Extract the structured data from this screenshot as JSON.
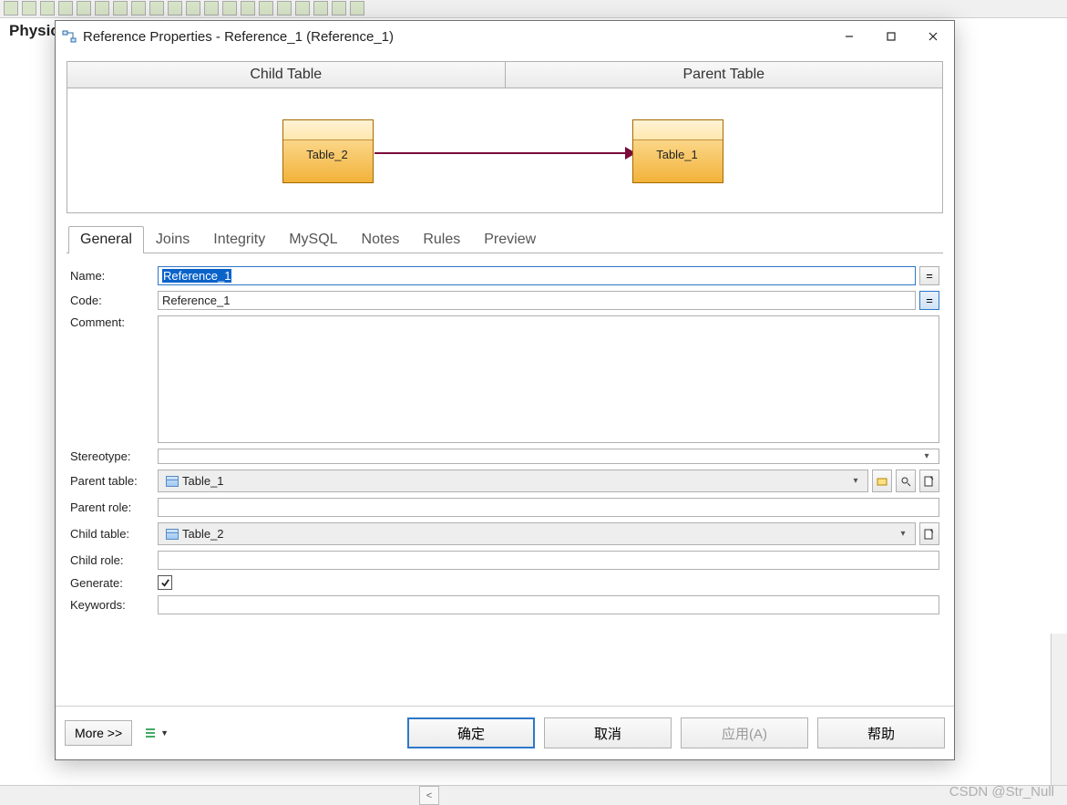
{
  "background": {
    "tab_label": "Physic"
  },
  "dialog": {
    "title": "Reference Properties - Reference_1 (Reference_1)",
    "rel": {
      "child_header": "Child Table",
      "parent_header": "Parent Table",
      "child_name": "Table_2",
      "parent_name": "Table_1"
    },
    "tabs": [
      "General",
      "Joins",
      "Integrity",
      "MySQL",
      "Notes",
      "Rules",
      "Preview"
    ],
    "active_tab": "General",
    "form": {
      "labels": {
        "name": "Name:",
        "code": "Code:",
        "comment": "Comment:",
        "stereotype": "Stereotype:",
        "parent_table": "Parent table:",
        "parent_role": "Parent role:",
        "child_table": "Child table:",
        "child_role": "Child role:",
        "generate": "Generate:",
        "keywords": "Keywords:"
      },
      "name_value": "Reference_1",
      "code_value": "Reference_1",
      "comment_value": "",
      "stereotype_value": "",
      "parent_table_value": "Table_1",
      "parent_role_value": "",
      "child_table_value": "Table_2",
      "child_role_value": "",
      "generate_checked": true,
      "keywords_value": "",
      "eq_sign": "="
    },
    "buttons": {
      "more": "More >>",
      "ok": "确定",
      "cancel": "取消",
      "apply": "应用(A)",
      "help": "帮助"
    }
  },
  "watermark": "CSDN @Str_Null"
}
